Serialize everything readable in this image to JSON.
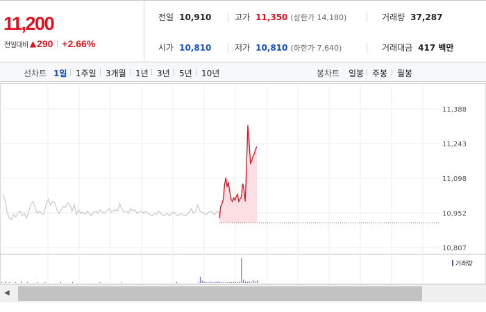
{
  "quote": {
    "price": "11,200",
    "change_label": "전일대비",
    "change_arrow": "▲",
    "change": "290",
    "change_pct": "+2.66%"
  },
  "stats": {
    "prev_close": {
      "label": "전일",
      "value": "10,910"
    },
    "high": {
      "label": "고가",
      "value": "11,350",
      "sub": "(상한가 14,180)"
    },
    "volume": {
      "label": "거래량",
      "value": "37,287"
    },
    "open": {
      "label": "시가",
      "value": "10,810"
    },
    "low": {
      "label": "저가",
      "value": "10,810",
      "sub": "(하한가 7,640)"
    },
    "amount": {
      "label": "거래대금",
      "value": "417 백만"
    }
  },
  "line_tabs": {
    "label": "선차트",
    "items": [
      "1일",
      "1주일",
      "3개월",
      "1년",
      "3년",
      "5년",
      "10년"
    ],
    "selected": "1일"
  },
  "candle_tabs": {
    "label": "봉차트",
    "items": [
      "일봉",
      "주봉",
      "월봉"
    ]
  },
  "colors": {
    "up": "#e0101e",
    "down": "#1450c8",
    "prev_line": "#c8c8c8",
    "today_fill": "#fcdfe2",
    "volume": "#5a4fcf"
  },
  "chart_data": {
    "type": "line",
    "yticks": [
      "11,388",
      "11,243",
      "11,098",
      "10,952",
      "10,807"
    ],
    "ytick_values": [
      11388,
      11243,
      11098,
      10952,
      10807
    ],
    "ylim": [
      10807,
      11388
    ],
    "baseline": 10910,
    "grid": true,
    "volume_legend": "거래량",
    "series": [
      {
        "values": [
          11030,
          11010,
          10955,
          10930,
          10925,
          10945,
          10935,
          10950,
          10960,
          10940,
          10950,
          10930,
          10960,
          10990,
          11000,
          10970,
          10950,
          10960,
          10950,
          10945,
          10990,
          11010,
          10985,
          11000,
          10995,
          10965,
          10950,
          10965,
          10980,
          10975,
          10995,
          10985,
          10960,
          10985,
          10945,
          10965,
          10950,
          10955,
          10945,
          10960,
          10950,
          10940,
          10955,
          10960,
          10950,
          10965,
          10955,
          10950,
          10960,
          10970,
          10955,
          10960,
          10965,
          10960,
          10990,
          10965,
          10955,
          10960,
          10950,
          10970,
          10960,
          10965,
          10950,
          10955,
          10960,
          10950,
          10960,
          10950,
          10945,
          10940,
          10950,
          10945,
          10960,
          10950,
          10940,
          10945,
          10950,
          10940,
          10950,
          10955,
          10945,
          10940,
          10950,
          10945,
          10940,
          10945,
          10955,
          10970,
          10950,
          10960,
          10985,
          10960,
          10955,
          10950,
          10945,
          10955,
          10960,
          10950,
          10945,
          10960,
          10950
        ]
      },
      {
        "values": [
          10930,
          10980,
          10990,
          11010,
          11070,
          11100,
          11060,
          11080,
          11040,
          11010,
          11000,
          11015,
          11005,
          11020,
          11030,
          11000,
          11010,
          11020,
          11075,
          11050,
          11000,
          11150,
          11320,
          11250,
          11160,
          11170,
          11190,
          11200,
          11220,
          11230
        ]
      }
    ],
    "volume": [
      1,
      0,
      2,
      0,
      1,
      0,
      0,
      1,
      0,
      0,
      2,
      0,
      0,
      1,
      0,
      0,
      0,
      0,
      1,
      0,
      0,
      0,
      1,
      0,
      0,
      0,
      0,
      0,
      0,
      0,
      1,
      0,
      0,
      0,
      0,
      0,
      1,
      0,
      0,
      0,
      0,
      0,
      0,
      0,
      0,
      0,
      0,
      0,
      0,
      0,
      1,
      0,
      0,
      0,
      0,
      0,
      0,
      0,
      0,
      0,
      0,
      1,
      0,
      0,
      0,
      0,
      0,
      0,
      0,
      0,
      0,
      0,
      0,
      0,
      0,
      0,
      0,
      0,
      0,
      0,
      0,
      0,
      0,
      0,
      0,
      0,
      0,
      0,
      0,
      1,
      0,
      0,
      0,
      0,
      0,
      0,
      0,
      0,
      0,
      0,
      1,
      8,
      3,
      2,
      1,
      1,
      2,
      1,
      1,
      1,
      2,
      1,
      1,
      1,
      1,
      1,
      1,
      1,
      1,
      1,
      1,
      2,
      32,
      4,
      2,
      1,
      2,
      1,
      4,
      2,
      3
    ]
  }
}
